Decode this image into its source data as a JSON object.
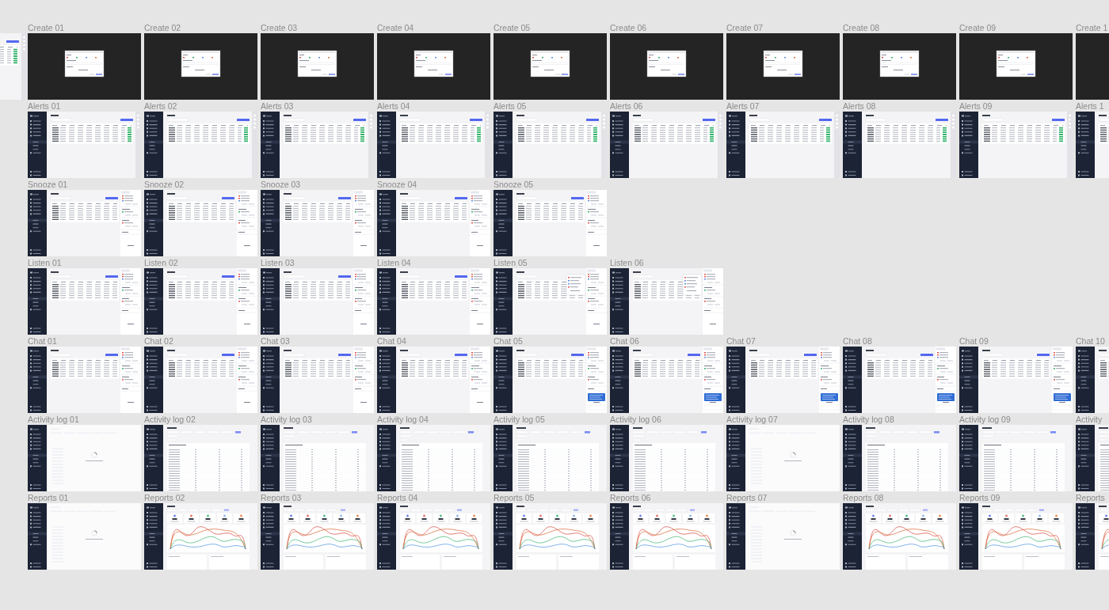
{
  "canvas": {
    "rows": [
      {
        "frames": [
          {
            "label": "Create 01",
            "kind": "dialog"
          },
          {
            "label": "Create 02",
            "kind": "dialog"
          },
          {
            "label": "Create 03",
            "kind": "dialog"
          },
          {
            "label": "Create 04",
            "kind": "dialog"
          },
          {
            "label": "Create 05",
            "kind": "dialog"
          },
          {
            "label": "Create 06",
            "kind": "dialog"
          },
          {
            "label": "Create 07",
            "kind": "dialog"
          },
          {
            "label": "Create 08",
            "kind": "dialog"
          },
          {
            "label": "Create 09",
            "kind": "dialog"
          },
          {
            "label": "Create 1",
            "kind": "dialog"
          }
        ]
      },
      {
        "frames": [
          {
            "label": "Alerts 01",
            "kind": "alerts"
          },
          {
            "label": "Alerts 02",
            "kind": "alerts"
          },
          {
            "label": "Alerts 03",
            "kind": "alerts"
          },
          {
            "label": "Alerts 04",
            "kind": "alerts"
          },
          {
            "label": "Alerts 05",
            "kind": "alerts"
          },
          {
            "label": "Alerts 06",
            "kind": "alerts"
          },
          {
            "label": "Alerts 07",
            "kind": "alerts"
          },
          {
            "label": "Alerts 08",
            "kind": "alerts"
          },
          {
            "label": "Alerts 09",
            "kind": "alerts"
          },
          {
            "label": "Alerts 1",
            "kind": "alerts"
          }
        ]
      },
      {
        "frames": [
          {
            "label": "Snooze 01",
            "kind": "panel"
          },
          {
            "label": "Snooze 02",
            "kind": "panel"
          },
          {
            "label": "Snooze 03",
            "kind": "panel"
          },
          {
            "label": "Snooze 04",
            "kind": "panel"
          },
          {
            "label": "Snooze 05",
            "kind": "panel"
          }
        ]
      },
      {
        "frames": [
          {
            "label": "Listen 01",
            "kind": "panel"
          },
          {
            "label": "Listen 02",
            "kind": "panel"
          },
          {
            "label": "Listen 03",
            "kind": "panel"
          },
          {
            "label": "Listen 04",
            "kind": "panel"
          },
          {
            "label": "Listen 05",
            "kind": "popup"
          },
          {
            "label": "Listen 06",
            "kind": "popup"
          }
        ]
      },
      {
        "frames": [
          {
            "label": "Chat 01",
            "kind": "panel"
          },
          {
            "label": "Chat 02",
            "kind": "panel"
          },
          {
            "label": "Chat 03",
            "kind": "panel"
          },
          {
            "label": "Chat 04",
            "kind": "panel"
          },
          {
            "label": "Chat 05",
            "kind": "chat"
          },
          {
            "label": "Chat 06",
            "kind": "chat"
          },
          {
            "label": "Chat 07",
            "kind": "chat"
          },
          {
            "label": "Chat 08",
            "kind": "chat"
          },
          {
            "label": "Chat 09",
            "kind": "chat"
          },
          {
            "label": "Chat 10",
            "kind": "chat"
          }
        ]
      },
      {
        "frames": [
          {
            "label": "Activity log 01",
            "kind": "loading"
          },
          {
            "label": "Activity log 02",
            "kind": "activity"
          },
          {
            "label": "Activity log 03",
            "kind": "activity"
          },
          {
            "label": "Activity log 04",
            "kind": "activity"
          },
          {
            "label": "Activity log 05",
            "kind": "activity"
          },
          {
            "label": "Activity log 06",
            "kind": "activity"
          },
          {
            "label": "Activity log 07",
            "kind": "loading"
          },
          {
            "label": "Activity log 08",
            "kind": "activity"
          },
          {
            "label": "Activity log 09",
            "kind": "activity"
          },
          {
            "label": "Activity",
            "kind": "activity"
          }
        ]
      },
      {
        "frames": [
          {
            "label": "Reports 01",
            "kind": "loading"
          },
          {
            "label": "Reports 02",
            "kind": "reports"
          },
          {
            "label": "Reports 03",
            "kind": "reports"
          },
          {
            "label": "Reports 04",
            "kind": "reports"
          },
          {
            "label": "Reports 05",
            "kind": "reports"
          },
          {
            "label": "Reports 06",
            "kind": "reports"
          },
          {
            "label": "Reports 07",
            "kind": "loading"
          },
          {
            "label": "Reports 08",
            "kind": "reports"
          },
          {
            "label": "Reports 09",
            "kind": "reports"
          },
          {
            "label": "Reports",
            "kind": "reports"
          }
        ]
      }
    ]
  }
}
